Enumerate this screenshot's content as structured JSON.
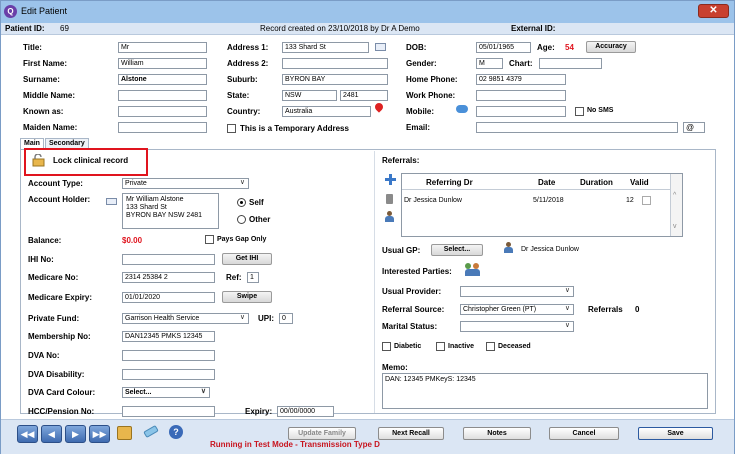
{
  "window": {
    "title": "Edit Patient",
    "close": "✕"
  },
  "info": {
    "patient_id_label": "Patient ID:",
    "patient_id": "69",
    "record_created": "Record created on 23/10/2018 by Dr A Demo",
    "external_id_label": "External ID:"
  },
  "col1": {
    "title_label": "Title:",
    "title": "Mr",
    "first_label": "First Name:",
    "first": "William",
    "surname_label": "Surname:",
    "surname": "Alstone",
    "middle_label": "Middle Name:",
    "middle": "",
    "known_label": "Known as:",
    "known": "",
    "maiden_label": "Maiden Name:",
    "maiden": ""
  },
  "col2": {
    "address1_label": "Address 1:",
    "address1": "133 Shard St",
    "address2_label": "Address 2:",
    "address2": "",
    "suburb_label": "Suburb:",
    "suburb": "BYRON BAY",
    "state_label": "State:",
    "state": "NSW",
    "postcode": "2481",
    "country_label": "Country:",
    "country": "Australia",
    "temp_address_label": "This is a Temporary Address"
  },
  "col3": {
    "dob_label": "DOB:",
    "dob": "05/01/1965",
    "age_label": "Age:",
    "age": "54",
    "accuracy_button": "Accuracy",
    "gender_label": "Gender:",
    "gender": "M",
    "chart_label": "Chart:",
    "chart": "",
    "home_phone_label": "Home Phone:",
    "home_phone": "02 9851 4379",
    "work_phone_label": "Work Phone:",
    "work_phone": "",
    "mobile_label": "Mobile:",
    "mobile": "",
    "no_sms_label": "No SMS",
    "email_label": "Email:",
    "email": ""
  },
  "tabs": {
    "main": "Main",
    "secondary": "Secondary"
  },
  "lock": {
    "label": "Lock clinical record"
  },
  "main": {
    "account_type_label": "Account Type:",
    "account_type": "Private",
    "account_holder_label": "Account Holder:",
    "account_holder_lines": [
      "Mr William Alstone",
      "133 Shard St",
      "BYRON BAY NSW 2481"
    ],
    "self_label": "Self",
    "other_label": "Other",
    "balance_label": "Balance:",
    "balance": "$0.00",
    "pays_gap_label": "Pays Gap Only",
    "ihi_label": "IHI No:",
    "ihi": "",
    "get_ihi_button": "Get IHI",
    "medicare_label": "Medicare No:",
    "medicare": "2314 25384 2",
    "ref_label": "Ref:",
    "ref": "1",
    "medicare_expiry_label": "Medicare Expiry:",
    "medicare_expiry": "01/01/2020",
    "swipe_button": "Swipe",
    "private_fund_label": "Private Fund:",
    "private_fund": "Garrison Health Service",
    "upi_label": "UPI:",
    "upi": "0",
    "membership_label": "Membership No:",
    "membership": "DAN12345 PMKS 12345",
    "dva_label": "DVA No:",
    "dva": "",
    "dva_disability_label": "DVA Disability:",
    "dva_disability": "",
    "dva_card_label": "DVA Card Colour:",
    "dva_card": "Select...",
    "hcc_label": "HCC/Pension No:",
    "hcc": "",
    "expiry_label": "Expiry:",
    "expiry": "00/00/0000"
  },
  "referrals": {
    "label": "Referrals:",
    "columns": [
      "Referring Dr",
      "Date",
      "Duration",
      "Valid"
    ],
    "rows": [
      {
        "dr": "Dr Jessica Dunlow",
        "date": "5/11/2018",
        "duration": "12"
      }
    ],
    "usual_gp_label": "Usual GP:",
    "select_button": "Select...",
    "usual_gp": "Dr Jessica Dunlow",
    "interested_label": "Interested Parties:",
    "usual_provider_label": "Usual Provider:",
    "usual_provider": "",
    "referral_source_label": "Referral Source:",
    "referral_source": "Christopher Green (PT)",
    "referrals_count_label": "Referrals",
    "referrals_count": "0",
    "marital_label": "Marital Status:",
    "marital": "",
    "diabetic_label": "Diabetic",
    "inactive_label": "Inactive",
    "deceased_label": "Deceased",
    "memo_label": "Memo:",
    "memo": "DAN: 12345 PMKeyS: 12345"
  },
  "bottom": {
    "nav_first": "◀◀",
    "nav_prev": "◀",
    "nav_next": "▶",
    "nav_last": "▶▶",
    "update_family": "Update Family",
    "next_recall": "Next Recall",
    "notes": "Notes",
    "cancel": "Cancel",
    "save": "Save",
    "test_mode": "Running in Test Mode - Transmission Type   D"
  },
  "colors": {
    "accent_red": "#e0141e",
    "titlebar": "#9cc3ea",
    "balance_red": "#e0141e"
  }
}
